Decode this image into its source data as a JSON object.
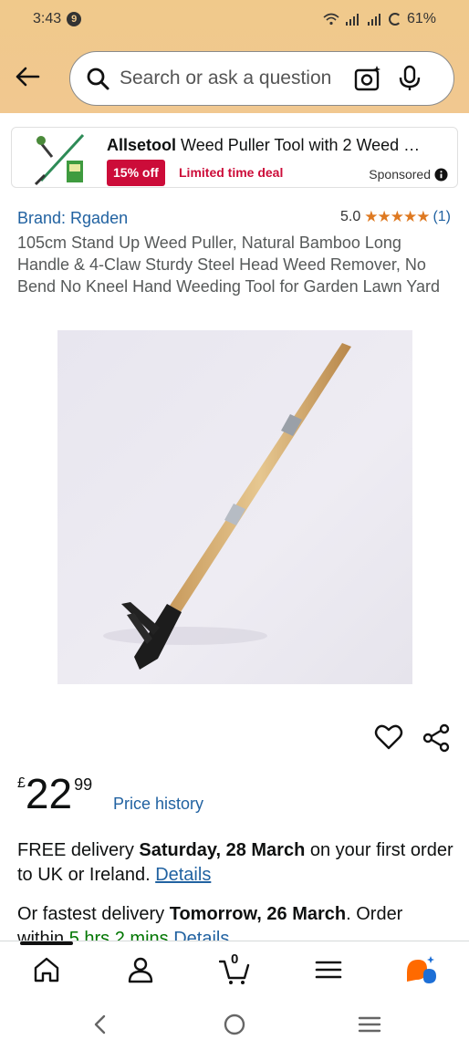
{
  "status_bar": {
    "time": "3:43",
    "notification_count": "9",
    "battery": "61%"
  },
  "search": {
    "placeholder": "Search or ask a question"
  },
  "sponsored_ad": {
    "brand": "Allsetool",
    "title": "Weed Puller Tool with 2 Weed …",
    "discount": "15% off",
    "deal": "Limited time deal",
    "sponsored_label": "Sponsored"
  },
  "product": {
    "brand": "Brand: Rgaden",
    "rating_value": "5.0",
    "stars": "★★★★★",
    "rating_count": "(1)",
    "title": "105cm Stand Up Weed Puller, Natural Bamboo Long Handle & 4-Claw Sturdy Steel Head Weed Remover, No Bend No Kneel Hand Weeding Tool for Garden Lawn Yard",
    "price_symbol": "£",
    "price_whole": "22",
    "price_fraction": "99",
    "price_history": "Price history"
  },
  "delivery": {
    "prefix": "FREE delivery",
    "date": "Saturday, 28 March",
    "suffix": "on your first order to UK or Ireland.",
    "details": "Details",
    "fast_prefix": "Or fastest delivery",
    "fast_date": "Tomorrow, 26 March",
    "fast_suffix": ". Order",
    "within": "within",
    "countdown": "5 hrs 2 mins",
    "fast_details": "Details"
  },
  "bottom_nav": {
    "cart_count": "0"
  },
  "colors": {
    "header": "#f0c98b",
    "link": "#2162a1",
    "deal_red": "#cc0c39",
    "star": "#de7921"
  }
}
